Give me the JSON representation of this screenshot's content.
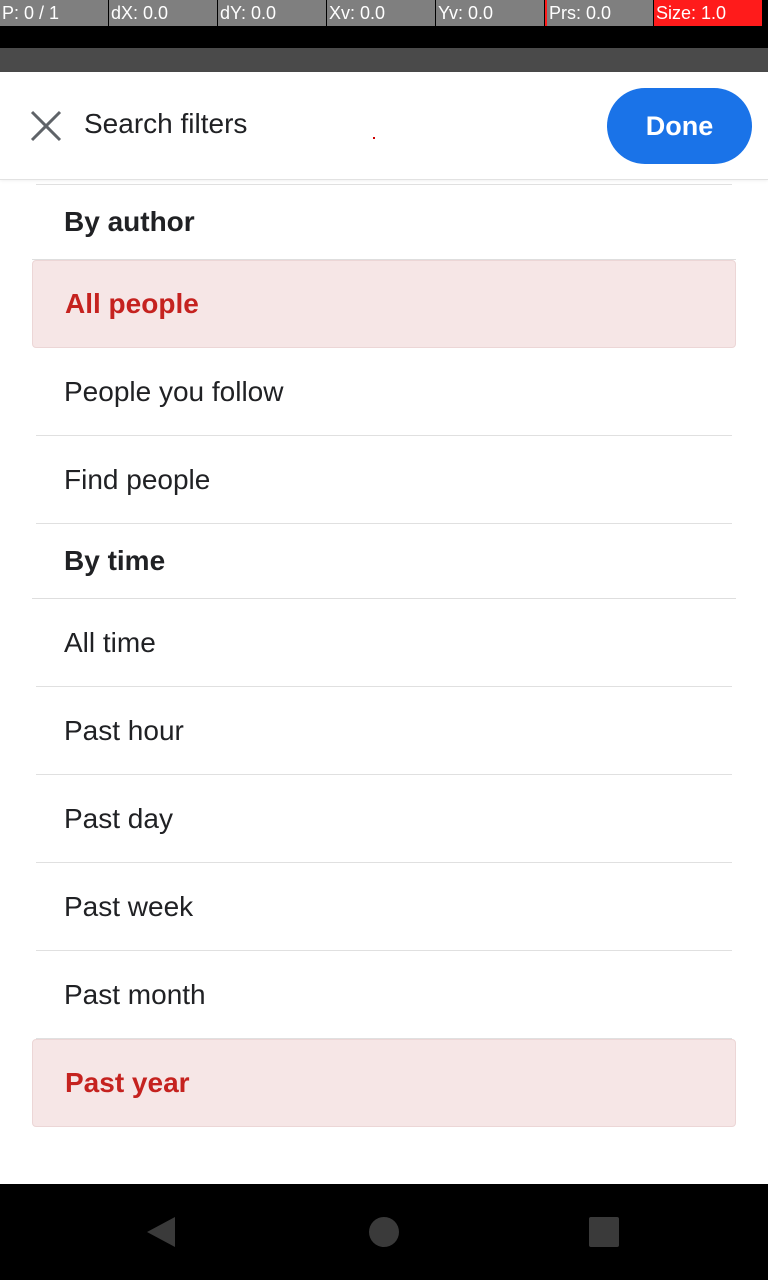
{
  "debug": {
    "p": "P: 0 / 1",
    "dx": "dX: 0.0",
    "dy": "dY: 0.0",
    "xv": "Xv: 0.0",
    "yv": "Yv: 0.0",
    "prs": "Prs: 0.0",
    "size": "Size: 1.0"
  },
  "header": {
    "close_icon": "close-icon",
    "title": "Search filters",
    "done_label": "Done"
  },
  "filters": {
    "author": {
      "heading": "By author",
      "options": [
        "All people",
        "People you follow",
        "Find people"
      ],
      "selected": "All people"
    },
    "time": {
      "heading": "By time",
      "options": [
        "All time",
        "Past hour",
        "Past day",
        "Past week",
        "Past month",
        "Past year"
      ],
      "selected": "Past year"
    }
  },
  "navbar": {
    "back_icon": "back-triangle-icon",
    "home_icon": "home-circle-icon",
    "recents_icon": "recents-square-icon"
  },
  "colors": {
    "accent_blue": "#1a73e8",
    "selected_bg": "#f6e6e6",
    "selected_text": "#c5221f"
  }
}
